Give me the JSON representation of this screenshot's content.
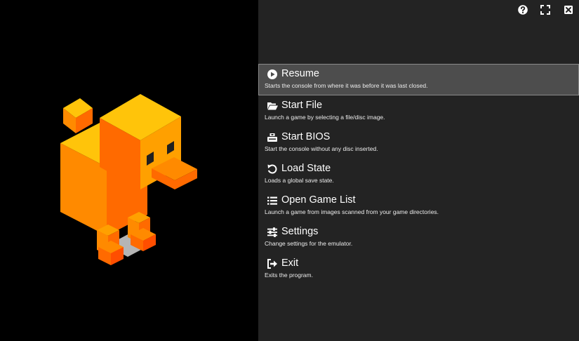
{
  "menu": {
    "items": [
      {
        "title": "Resume",
        "desc": "Starts the console from where it was before it was last closed.",
        "icon": "play-circle-icon",
        "selected": true
      },
      {
        "title": "Start File",
        "desc": "Launch a game by selecting a file/disc image.",
        "icon": "folder-open-icon"
      },
      {
        "title": "Start BIOS",
        "desc": "Start the console without any disc inserted.",
        "icon": "chip-icon"
      },
      {
        "title": "Load State",
        "desc": "Loads a global save state.",
        "icon": "undo-icon"
      },
      {
        "title": "Open Game List",
        "desc": "Launch a game from images scanned from your game directories.",
        "icon": "list-icon"
      },
      {
        "title": "Settings",
        "desc": "Change settings for the emulator.",
        "icon": "sliders-icon"
      },
      {
        "title": "Exit",
        "desc": "Exits the program.",
        "icon": "sign-out-icon"
      }
    ]
  },
  "top_icons": [
    "help-icon",
    "fullscreen-icon",
    "close-icon"
  ],
  "colors": {
    "panel_bg": "#232323",
    "selected_bg": "#4d4d4d",
    "selected_border": "#8a8a8a",
    "duck_light": "#ffc40a",
    "duck_orange": "#ff8a00",
    "duck_dark": "#ff6a00"
  }
}
